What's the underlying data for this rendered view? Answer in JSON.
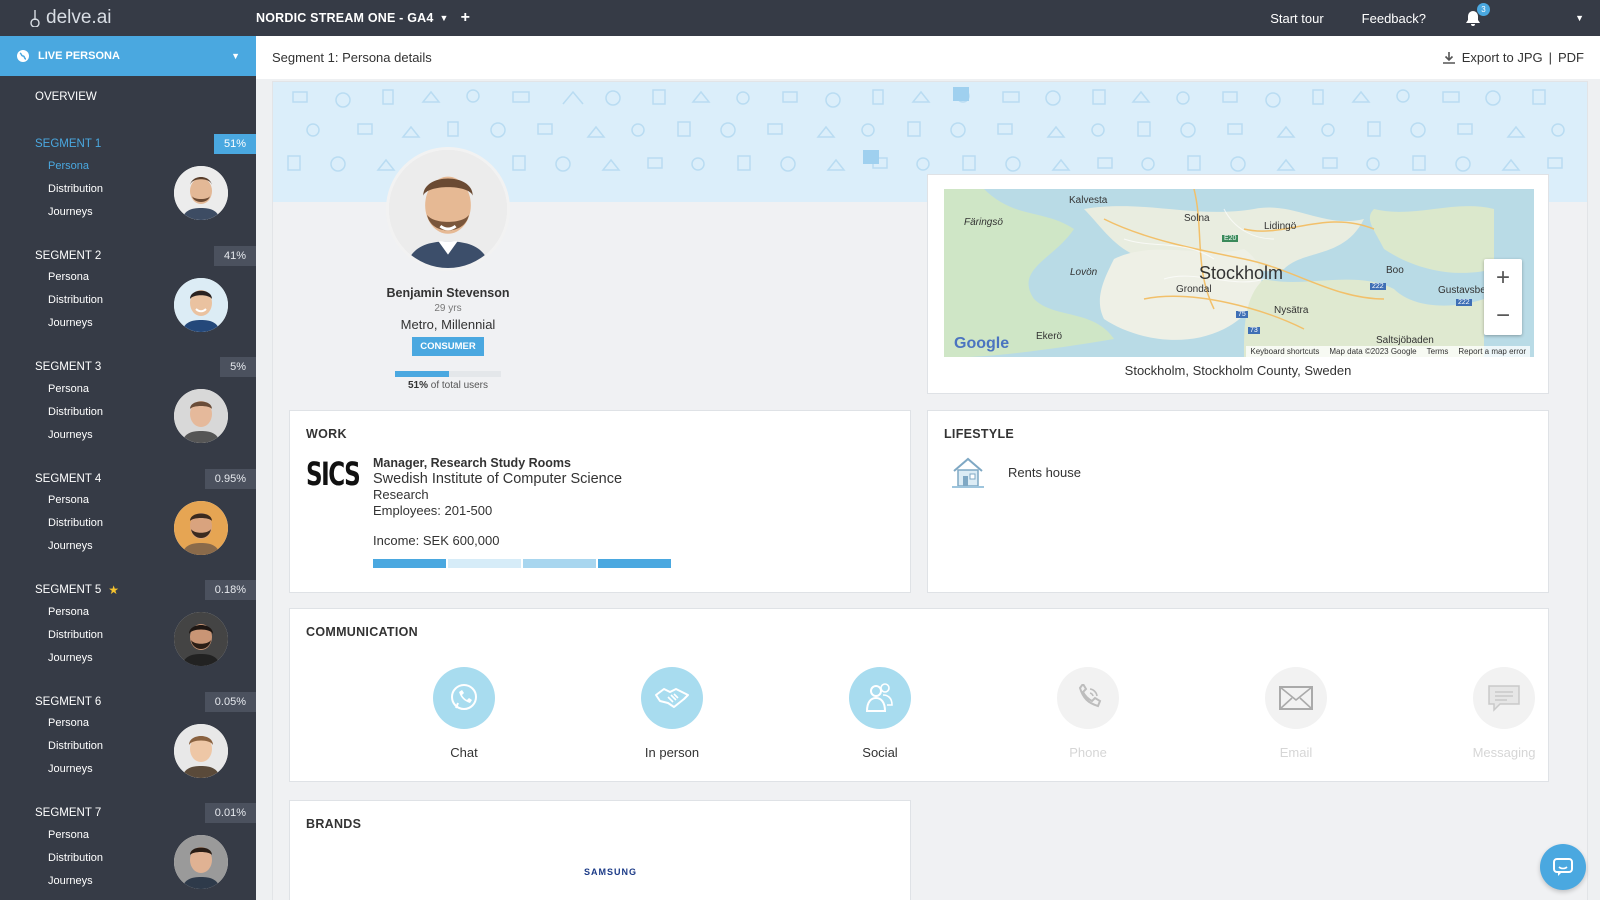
{
  "app": {
    "logo_text": "delve.ai",
    "project": "NORDIC STREAM ONE - GA4"
  },
  "topbar": {
    "start_tour": "Start tour",
    "feedback": "Feedback?",
    "notifications": "3"
  },
  "sidebar": {
    "live_persona": "LIVE PERSONA",
    "overview": "OVERVIEW",
    "segments": [
      {
        "label": "SEGMENT 1",
        "pct": "51%",
        "persona": "Persona",
        "distribution": "Distribution",
        "journeys": "Journeys"
      },
      {
        "label": "SEGMENT 2",
        "pct": "41%",
        "persona": "Persona",
        "distribution": "Distribution",
        "journeys": "Journeys"
      },
      {
        "label": "SEGMENT 3",
        "pct": "5%",
        "persona": "Persona",
        "distribution": "Distribution",
        "journeys": "Journeys"
      },
      {
        "label": "SEGMENT 4",
        "pct": "0.95%",
        "persona": "Persona",
        "distribution": "Distribution",
        "journeys": "Journeys"
      },
      {
        "label": "SEGMENT 5",
        "pct": "0.18%",
        "persona": "Persona",
        "distribution": "Distribution",
        "journeys": "Journeys"
      },
      {
        "label": "SEGMENT 6",
        "pct": "0.05%",
        "persona": "Persona",
        "distribution": "Distribution",
        "journeys": "Journeys"
      },
      {
        "label": "SEGMENT 7",
        "pct": "0.01%",
        "persona": "Persona",
        "distribution": "Distribution",
        "journeys": "Journeys"
      }
    ]
  },
  "header": {
    "title": "Segment 1: Persona details",
    "export_label": "Export to JPG",
    "sep": "|",
    "pdf": "PDF"
  },
  "persona": {
    "name": "Benjamin Stevenson",
    "age": "29 yrs",
    "location": "Metro, Millennial",
    "tag": "CONSUMER",
    "users_pct": "51%",
    "users_text": "of total users",
    "users_fraction": 0.51
  },
  "map": {
    "caption": "Stockholm, Stockholm County, Sweden",
    "labels": {
      "kalvesta": "Kalvesta",
      "solna": "Solna",
      "lidingo": "Lidingö",
      "faringso": "Färingsö",
      "lovon": "Lovön",
      "stockholm": "Stockholm",
      "grondal": "Grondal",
      "boo": "Boo",
      "gustavsberg": "Gustavsbe",
      "nysatra": "Nysätra",
      "ekero": "Ekerö",
      "saltsjobaden": "Saltsjöbaden",
      "e20": "E20",
      "r222a": "222",
      "r222b": "222",
      "r75": "75",
      "r73": "73"
    },
    "google": "Google",
    "footer": {
      "shortcuts": "Keyboard shortcuts",
      "data": "Map data ©2023 Google",
      "terms": "Terms",
      "report": "Report a map error"
    },
    "zoom_in": "+",
    "zoom_out": "−"
  },
  "work": {
    "title": "WORK",
    "logo": "SICS",
    "role": "Manager, Research Study Rooms",
    "org": "Swedish Institute of Computer Science",
    "industry": "Research",
    "employees": "Employees: 201-500",
    "income": "Income: SEK 600,000"
  },
  "lifestyle": {
    "title": "LIFESTYLE",
    "item": "Rents house"
  },
  "communication": {
    "title": "COMMUNICATION",
    "channels": [
      {
        "label": "Chat",
        "active": true
      },
      {
        "label": "In person",
        "active": true
      },
      {
        "label": "Social",
        "active": true
      },
      {
        "label": "Phone",
        "active": false
      },
      {
        "label": "Email",
        "active": false
      },
      {
        "label": "Messaging",
        "active": false
      }
    ]
  },
  "brands": {
    "title": "BRANDS",
    "items": [
      "SAMSUNG"
    ]
  },
  "colors": {
    "accent": "#4aa8e0",
    "sidebar": "#363b46",
    "banner": "#dbeefa",
    "channel_on": "#a8dcef"
  }
}
